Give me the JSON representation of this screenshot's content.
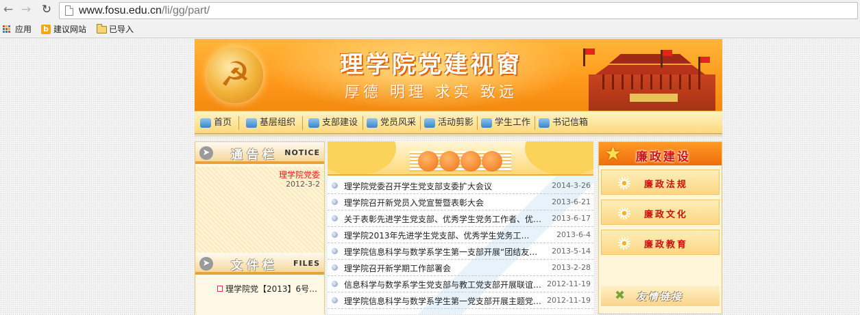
{
  "browser": {
    "url_host": "www.fosu.edu.cn",
    "url_path": "/li/gg/part/",
    "bookmarks": [
      {
        "label": "应用",
        "icon": "apps-grid-icon"
      },
      {
        "label": "建议网站",
        "icon": "bing-icon"
      },
      {
        "label": "已导入",
        "icon": "folder-icon"
      }
    ]
  },
  "banner": {
    "title": "理学院党建视窗",
    "motto": "厚德 明理 求实 致远"
  },
  "menu": [
    {
      "label": "首页",
      "icon": "home-icon"
    },
    {
      "label": "基层组织",
      "icon": "mail-icon"
    },
    {
      "label": "支部建设",
      "icon": "globe-icon"
    },
    {
      "label": "党员风采",
      "icon": "people-icon"
    },
    {
      "label": "活动剪影",
      "icon": "scissors-icon"
    },
    {
      "label": "学生工作",
      "icon": "diamond-icon"
    },
    {
      "label": "书记信箱",
      "icon": "mailbox-icon"
    }
  ],
  "notice": {
    "title": "通告栏",
    "title_en": "NOTICE",
    "items": [
      {
        "text": "理学院党委",
        "date": "2012-3-2"
      }
    ]
  },
  "files": {
    "title": "文件栏",
    "title_en": "FILES",
    "items": [
      {
        "text": "理学院党【2013】6号…"
      }
    ]
  },
  "news": [
    {
      "title": "理学院党委召开学生党支部支委扩大会议",
      "date": "2014-3-26"
    },
    {
      "title": "理学院召开新党员入党宣誓暨表彰大会",
      "date": "2013-6-21"
    },
    {
      "title": "关于表彰先进学生党支部、优秀学生党务工作者、优…",
      "date": "2013-6-17"
    },
    {
      "title": "理学院2013年先进学生党支部、优秀学生党务工…",
      "date": "2013-6-4"
    },
    {
      "title": "理学院信息科学与数学系学生第一支部开展“团结友…",
      "date": "2013-5-14"
    },
    {
      "title": "理学院召开新学期工作部署会",
      "date": "2013-2-28"
    },
    {
      "title": "信息科学与数学系学生党支部与教工党支部开展联谊…",
      "date": "2012-11-19"
    },
    {
      "title": "理学院信息科学与数学系学生第一党支部开展主题党…",
      "date": "2012-11-19"
    }
  ],
  "right": {
    "title": "廉政建设",
    "items": [
      {
        "label": "廉政法规"
      },
      {
        "label": "廉政文化"
      },
      {
        "label": "廉政教育"
      }
    ],
    "friend_title": "友情链接"
  },
  "colors": {
    "banner": "#ff9a1c",
    "accent_red": "#d4120e",
    "menu_bg": "#fbd97c"
  }
}
